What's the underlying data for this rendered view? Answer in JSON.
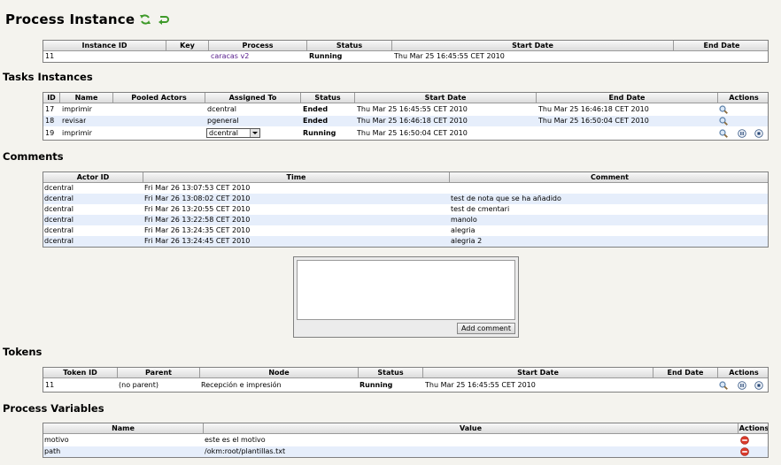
{
  "page": {
    "title": "Process Instance"
  },
  "process_instance": {
    "headers": [
      "Instance ID",
      "Key",
      "Process",
      "Status",
      "Start Date",
      "End Date"
    ],
    "row": {
      "id": "11",
      "key": "",
      "process": "caracas v2",
      "status": "Running",
      "start": "Thu Mar 25 16:45:55 CET 2010",
      "end": ""
    }
  },
  "tasks": {
    "title": "Tasks Instances",
    "headers": [
      "ID",
      "Name",
      "Pooled Actors",
      "Assigned To",
      "Status",
      "Start Date",
      "End Date",
      "Actions"
    ],
    "rows": [
      {
        "id": "17",
        "name": "imprimir",
        "pooled": "",
        "assigned": "dcentral",
        "status": "Ended",
        "start": "Thu Mar 25 16:45:55 CET 2010",
        "end": "Thu Mar 25 16:46:18 CET 2010"
      },
      {
        "id": "18",
        "name": "revisar",
        "pooled": "",
        "assigned": "pgeneral",
        "status": "Ended",
        "start": "Thu Mar 25 16:46:18 CET 2010",
        "end": "Thu Mar 25 16:50:04 CET 2010"
      },
      {
        "id": "19",
        "name": "imprimir",
        "pooled": "",
        "assigned": "dcentral",
        "status": "Running",
        "start": "Thu Mar 25 16:50:04 CET 2010",
        "end": ""
      }
    ]
  },
  "comments": {
    "title": "Comments",
    "headers": [
      "Actor ID",
      "Time",
      "Comment"
    ],
    "rows": [
      {
        "actor": "dcentral",
        "time": "Fri Mar 26 13:07:53 CET 2010",
        "comment": ""
      },
      {
        "actor": "dcentral",
        "time": "Fri Mar 26 13:08:02 CET 2010",
        "comment": "test de nota que se ha añadido"
      },
      {
        "actor": "dcentral",
        "time": "Fri Mar 26 13:20:55 CET 2010",
        "comment": "test de cmentari"
      },
      {
        "actor": "dcentral",
        "time": "Fri Mar 26 13:22:58 CET 2010",
        "comment": "manolo"
      },
      {
        "actor": "dcentral",
        "time": "Fri Mar 26 13:24:35 CET 2010",
        "comment": "alegria"
      },
      {
        "actor": "dcentral",
        "time": "Fri Mar 26 13:24:45 CET 2010",
        "comment": "alegria 2"
      }
    ],
    "input_value": "",
    "add_label": "Add comment"
  },
  "tokens": {
    "title": "Tokens",
    "headers": [
      "Token ID",
      "Parent",
      "Node",
      "Status",
      "Start Date",
      "End Date",
      "Actions"
    ],
    "row": {
      "id": "11",
      "parent": "(no parent)",
      "node": "Recepción e impresión",
      "status": "Running",
      "start": "Thu Mar 25 16:45:55 CET 2010",
      "end": ""
    }
  },
  "variables": {
    "title": "Process Variables",
    "headers": [
      "Name",
      "Value",
      "Actions"
    ],
    "rows": [
      {
        "name": "motivo",
        "value": "este es el motivo"
      },
      {
        "name": "path",
        "value": "/okm:root/plantillas.txt"
      }
    ]
  },
  "icons": {
    "refresh": "refresh-icon",
    "back": "back-icon",
    "view": "magnifier-icon",
    "suspend": "pause-icon",
    "end": "stop-icon",
    "delete": "delete-icon"
  },
  "colors": {
    "header_bg": "#dcdcdc",
    "alt_row": "#e6eefb",
    "link": "#551a8b",
    "delete_red": "#d93a2b",
    "icon_green": "#3f9a2a"
  }
}
